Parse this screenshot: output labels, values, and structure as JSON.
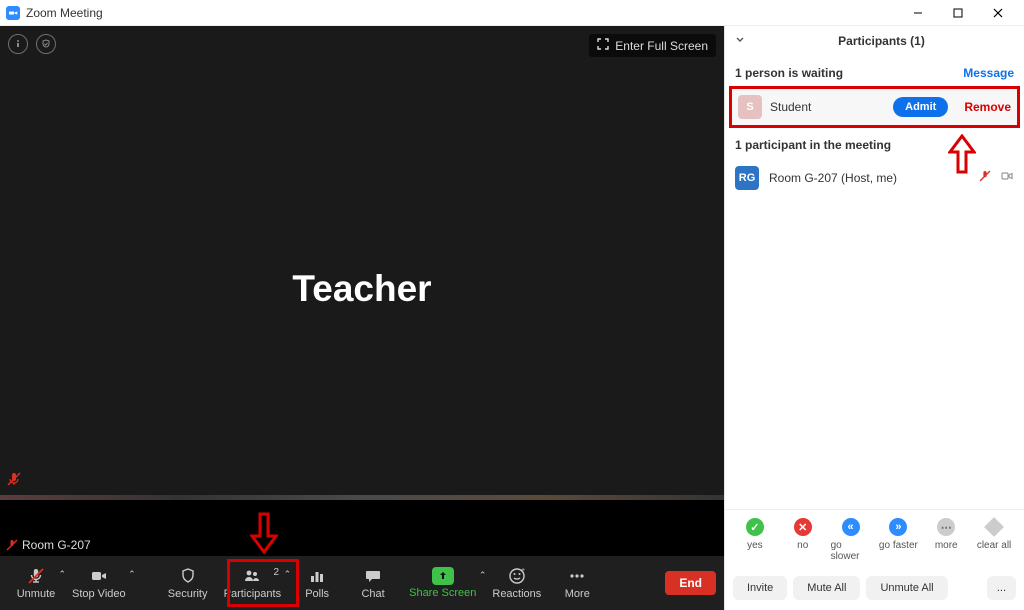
{
  "window": {
    "title": "Zoom Meeting"
  },
  "video": {
    "fullscreen_label": "Enter Full Screen",
    "speaker_name": "Teacher",
    "self_name": "Room G-207"
  },
  "controls": {
    "unmute": "Unmute",
    "stop_video": "Stop Video",
    "security": "Security",
    "participants": "Participants",
    "participants_count": "2",
    "polls": "Polls",
    "chat": "Chat",
    "share_screen": "Share Screen",
    "reactions": "Reactions",
    "more": "More",
    "end": "End"
  },
  "side": {
    "header": "Participants (1)",
    "waiting_header": "1 person is waiting",
    "message_link": "Message",
    "waiting": [
      {
        "initial": "S",
        "name": "Student"
      }
    ],
    "admit": "Admit",
    "remove": "Remove",
    "in_meeting_header": "1 participant in the meeting",
    "in_meeting": [
      {
        "initial": "RG",
        "name": "Room G-207 (Host, me)",
        "muted": true
      }
    ]
  },
  "feedback": {
    "yes": "yes",
    "no": "no",
    "go_slower": "go slower",
    "go_faster": "go faster",
    "more": "more",
    "clear_all": "clear all"
  },
  "bottom": {
    "invite": "Invite",
    "mute_all": "Mute All",
    "unmute_all": "Unmute All",
    "more": "..."
  }
}
